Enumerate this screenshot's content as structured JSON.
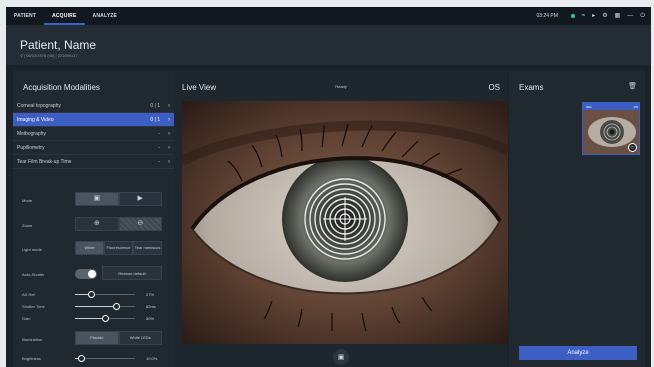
{
  "nav": {
    "tabs": [
      {
        "label": "PATIENT"
      },
      {
        "label": "ACQUIRE"
      },
      {
        "label": "ANALYZE"
      }
    ],
    "clock": "03:24 PM"
  },
  "patient": {
    "name": "Patient, Name",
    "meta": "⚲ | 06/03/1976 (45) | 221690117"
  },
  "acquisition": {
    "title": "Acquisition Modalities",
    "modalities": [
      {
        "label": "Corneal topography",
        "count": "0 | 1"
      },
      {
        "label": "Imaging & Video",
        "count": "0 | 1"
      },
      {
        "label": "Meibography",
        "count": "-"
      },
      {
        "label": "Pupillometry",
        "count": "-"
      },
      {
        "label": "Tear Film Break-up Time",
        "count": "-"
      }
    ],
    "mode_label": "Mode",
    "zoom_label": "Zoom",
    "light_mode_label": "Light mode",
    "light_modes": [
      "White",
      "Fluorescence",
      "Tear meniscus"
    ],
    "auto_shutter_label": "Auto-Shutter",
    "restore_label": "Restore default",
    "sliders": [
      {
        "label": "AS Ref",
        "value": "27%",
        "level": 0.27
      },
      {
        "label": "Shutter Time",
        "value": "82ms",
        "level": 0.68
      },
      {
        "label": "Gain",
        "value": "50%",
        "level": 0.5
      }
    ],
    "illumination_label": "Illumination",
    "illuminations": [
      "Placido",
      "White LEDs"
    ],
    "brightness_label": "Brightness",
    "brightness_value": "10.0%",
    "brightness_level": 0.1
  },
  "live": {
    "title": "Live View",
    "status": "Ready",
    "eye": "OS"
  },
  "exams": {
    "title": "Exams",
    "thumb_left": "IMG",
    "thumb_right": "OS",
    "analyze_label": "Analyze"
  }
}
